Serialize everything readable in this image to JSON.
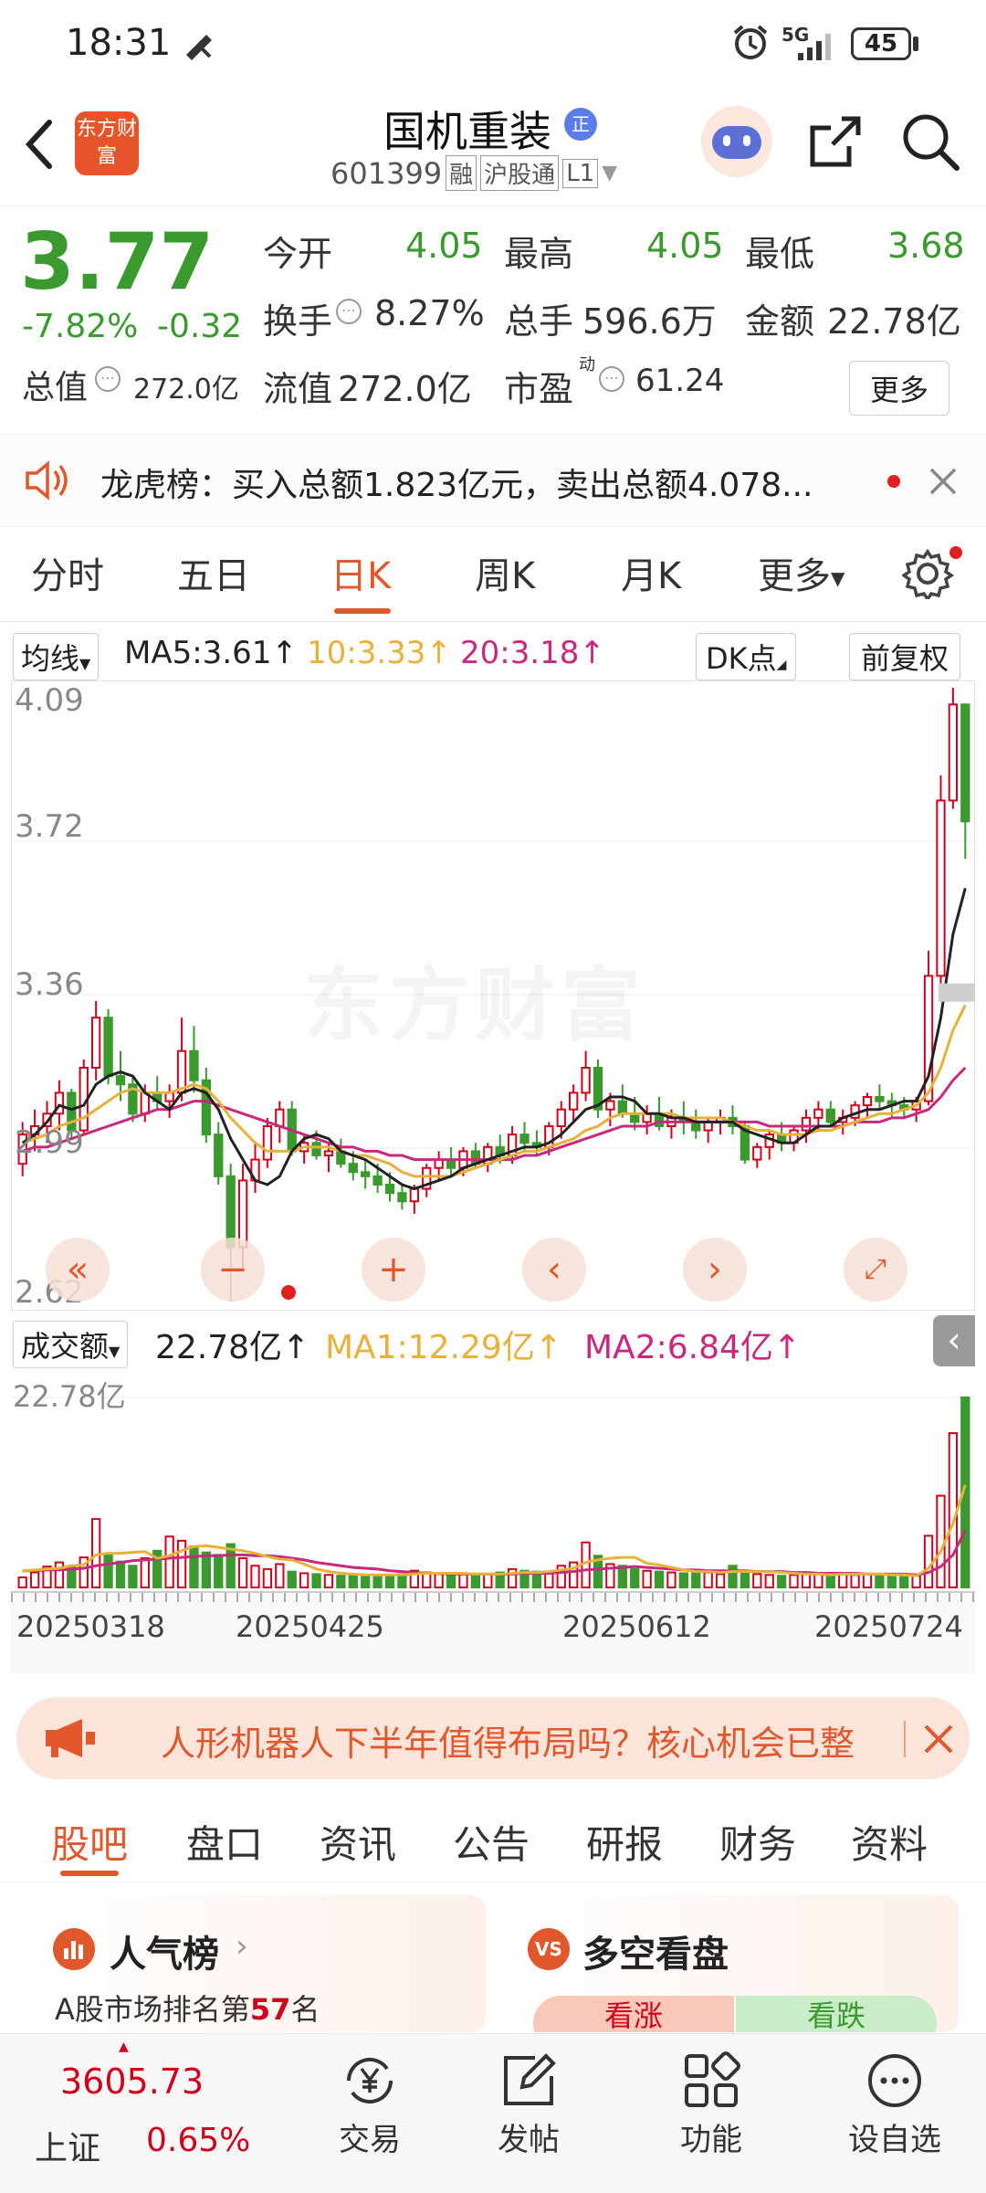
{
  "status": {
    "time": "18:31",
    "battery": "45",
    "network": "5G"
  },
  "header": {
    "app_badge": "东方财富",
    "stock_name": "国机重装",
    "code": "601399",
    "tag_margin": "融",
    "tag_connect": "沪股通",
    "tag_level": "L1",
    "badge_official": "正"
  },
  "quote": {
    "price": "3.77",
    "change_pct": "-7.82%",
    "change": "-0.32",
    "open_label": "今开",
    "open": "4.05",
    "high_label": "最高",
    "high": "4.05",
    "low_label": "最低",
    "low": "3.68",
    "turnover_label": "换手",
    "turnover": "8.27%",
    "volume_label": "总手",
    "volume": "596.6万",
    "amount_label": "金额",
    "amount": "22.78亿",
    "mcap_label": "总值",
    "mcap": "272.0亿",
    "float_label": "流值",
    "float": "272.0亿",
    "pe_label": "市盈",
    "pe_sup": "动",
    "pe": "61.24",
    "more_label": "更多"
  },
  "lhb": {
    "text": "龙虎榜：买入总额1.823亿元，卖出总额4.078..."
  },
  "tabs": [
    "分时",
    "五日",
    "日K",
    "周K",
    "月K",
    "更多"
  ],
  "ma_bar": {
    "selector": "均线",
    "ma5": "MA5:3.61↑",
    "ma10": "10:3.33↑",
    "ma20": "20:3.18↑",
    "dk": "DK点",
    "adjust": "前复权"
  },
  "chart": {
    "price_labels": [
      "4.09",
      "3.72",
      "3.36",
      "2.99",
      "2.62"
    ],
    "watermark": "东方财富"
  },
  "vol_bar": {
    "selector": "成交额",
    "value": "22.78亿↑",
    "ma1": "MA1:12.29亿↑",
    "ma2": "MA2:6.84亿↑",
    "axis_label": "22.78亿",
    "dates": [
      "20250318",
      "20250425",
      "20250612",
      "20250724"
    ]
  },
  "banner": {
    "text": "人形机器人下半年值得布局吗？核心机会已整"
  },
  "subtabs": [
    "股吧",
    "盘口",
    "资讯",
    "公告",
    "研报",
    "财务",
    "资料"
  ],
  "cards": {
    "left_title": "人气榜",
    "left_text_prefix": "A股市场排名第",
    "left_rank": "57",
    "left_text_suffix": "名",
    "right_title": "多空看盘",
    "right_up": "看涨",
    "right_down": "看跌"
  },
  "bottom": {
    "index_value": "3605.73",
    "index_name": "上证",
    "index_change": "0.65%",
    "nav": [
      "交易",
      "发帖",
      "功能",
      "设自选"
    ]
  },
  "colors": {
    "accent": "#e0582b",
    "up": "#d0021b",
    "down": "#3a9a2e",
    "ma5": "#222222",
    "ma10": "#e8b13a",
    "ma20": "#c8287e"
  },
  "chart_data": {
    "type": "candlestick",
    "ylim": [
      2.62,
      4.09
    ],
    "candles": [
      [
        2.95,
        3.05,
        2.92,
        3.02
      ],
      [
        3.02,
        3.08,
        2.98,
        3.04
      ],
      [
        3.04,
        3.1,
        3.0,
        3.07
      ],
      [
        3.07,
        3.15,
        3.03,
        3.12
      ],
      [
        3.12,
        3.13,
        3.01,
        3.03
      ],
      [
        3.03,
        3.2,
        3.02,
        3.18
      ],
      [
        3.18,
        3.34,
        3.15,
        3.3
      ],
      [
        3.3,
        3.32,
        3.14,
        3.16
      ],
      [
        3.16,
        3.22,
        3.1,
        3.14
      ],
      [
        3.14,
        3.16,
        3.05,
        3.07
      ],
      [
        3.07,
        3.14,
        3.05,
        3.12
      ],
      [
        3.12,
        3.16,
        3.08,
        3.1
      ],
      [
        3.1,
        3.14,
        3.06,
        3.12
      ],
      [
        3.12,
        3.3,
        3.1,
        3.22
      ],
      [
        3.22,
        3.28,
        3.12,
        3.15
      ],
      [
        3.15,
        3.18,
        3.0,
        3.02
      ],
      [
        3.02,
        3.05,
        2.9,
        2.92
      ],
      [
        2.92,
        2.95,
        2.62,
        2.75
      ],
      [
        2.75,
        2.95,
        2.7,
        2.91
      ],
      [
        2.91,
        3.0,
        2.88,
        2.96
      ],
      [
        2.96,
        3.06,
        2.94,
        3.04
      ],
      [
        3.04,
        3.1,
        3.0,
        3.08
      ],
      [
        3.08,
        3.1,
        2.97,
        2.98
      ],
      [
        2.98,
        3.02,
        2.95,
        3.0
      ],
      [
        3.0,
        3.03,
        2.96,
        2.97
      ],
      [
        2.97,
        3.0,
        2.93,
        2.98
      ],
      [
        2.98,
        3.01,
        2.94,
        2.95
      ],
      [
        2.95,
        2.98,
        2.91,
        2.93
      ],
      [
        2.93,
        2.96,
        2.89,
        2.92
      ],
      [
        2.92,
        2.95,
        2.88,
        2.9
      ],
      [
        2.9,
        2.93,
        2.86,
        2.88
      ],
      [
        2.88,
        2.9,
        2.84,
        2.86
      ],
      [
        2.86,
        2.9,
        2.83,
        2.89
      ],
      [
        2.89,
        2.95,
        2.87,
        2.94
      ],
      [
        2.94,
        2.98,
        2.91,
        2.96
      ],
      [
        2.96,
        2.99,
        2.92,
        2.94
      ],
      [
        2.94,
        2.99,
        2.92,
        2.98
      ],
      [
        2.98,
        3.0,
        2.94,
        2.95
      ],
      [
        2.95,
        3.0,
        2.93,
        2.99
      ],
      [
        2.99,
        3.02,
        2.95,
        2.97
      ],
      [
        2.97,
        3.04,
        2.95,
        3.02
      ],
      [
        3.02,
        3.05,
        2.98,
        3.0
      ],
      [
        3.0,
        3.03,
        2.97,
        2.99
      ],
      [
        2.99,
        3.05,
        2.97,
        3.04
      ],
      [
        3.04,
        3.1,
        3.01,
        3.08
      ],
      [
        3.08,
        3.14,
        3.05,
        3.12
      ],
      [
        3.12,
        3.22,
        3.1,
        3.18
      ],
      [
        3.18,
        3.2,
        3.06,
        3.08
      ],
      [
        3.08,
        3.12,
        3.04,
        3.1
      ],
      [
        3.1,
        3.14,
        3.06,
        3.07
      ],
      [
        3.07,
        3.11,
        3.03,
        3.05
      ],
      [
        3.05,
        3.09,
        3.02,
        3.07
      ],
      [
        3.07,
        3.11,
        3.03,
        3.04
      ],
      [
        3.04,
        3.08,
        3.01,
        3.06
      ],
      [
        3.06,
        3.1,
        3.02,
        3.05
      ],
      [
        3.05,
        3.08,
        3.01,
        3.03
      ],
      [
        3.03,
        3.06,
        3.0,
        3.05
      ],
      [
        3.05,
        3.08,
        3.02,
        3.06
      ],
      [
        3.06,
        3.09,
        3.02,
        3.04
      ],
      [
        3.04,
        3.05,
        2.95,
        2.96
      ],
      [
        2.96,
        3.0,
        2.94,
        2.99
      ],
      [
        2.99,
        3.03,
        2.96,
        3.02
      ],
      [
        3.02,
        3.05,
        2.98,
        3.0
      ],
      [
        3.0,
        3.04,
        2.98,
        3.03
      ],
      [
        3.03,
        3.08,
        3.0,
        3.06
      ],
      [
        3.06,
        3.1,
        3.03,
        3.08
      ],
      [
        3.08,
        3.1,
        3.04,
        3.05
      ],
      [
        3.05,
        3.08,
        3.02,
        3.06
      ],
      [
        3.06,
        3.1,
        3.04,
        3.09
      ],
      [
        3.09,
        3.12,
        3.06,
        3.11
      ],
      [
        3.11,
        3.14,
        3.08,
        3.1
      ],
      [
        3.1,
        3.12,
        3.06,
        3.09
      ],
      [
        3.09,
        3.11,
        3.06,
        3.08
      ],
      [
        3.08,
        3.11,
        3.05,
        3.1
      ],
      [
        3.1,
        3.46,
        3.09,
        3.4
      ],
      [
        3.4,
        3.88,
        3.38,
        3.82
      ],
      [
        3.82,
        4.09,
        3.8,
        4.05
      ],
      [
        4.05,
        4.05,
        3.68,
        3.77
      ]
    ],
    "ma5": [
      3.0,
      3.02,
      3.05,
      3.09,
      3.08,
      3.09,
      3.14,
      3.16,
      3.17,
      3.16,
      3.12,
      3.1,
      3.08,
      3.12,
      3.13,
      3.12,
      3.08,
      3.01,
      2.96,
      2.91,
      2.9,
      2.92,
      2.98,
      3.01,
      3.02,
      3.01,
      2.98,
      2.97,
      2.96,
      2.94,
      2.92,
      2.9,
      2.89,
      2.9,
      2.91,
      2.92,
      2.94,
      2.95,
      2.96,
      2.97,
      2.98,
      2.99,
      2.99,
      3.0,
      3.02,
      3.05,
      3.08,
      3.09,
      3.11,
      3.11,
      3.1,
      3.07,
      3.07,
      3.06,
      3.06,
      3.05,
      3.05,
      3.05,
      3.05,
      3.03,
      3.02,
      3.01,
      3.0,
      3.0,
      3.02,
      3.04,
      3.04,
      3.06,
      3.07,
      3.08,
      3.08,
      3.09,
      3.1,
      3.1,
      3.16,
      3.3,
      3.5,
      3.61
    ],
    "ma10": [
      3.0,
      3.01,
      3.02,
      3.04,
      3.05,
      3.06,
      3.08,
      3.1,
      3.12,
      3.13,
      3.12,
      3.12,
      3.12,
      3.13,
      3.14,
      3.13,
      3.1,
      3.06,
      3.03,
      3.0,
      2.98,
      2.98,
      2.98,
      2.99,
      2.99,
      2.99,
      2.98,
      2.97,
      2.97,
      2.96,
      2.95,
      2.93,
      2.92,
      2.92,
      2.92,
      2.92,
      2.93,
      2.94,
      2.95,
      2.96,
      2.97,
      2.98,
      2.98,
      2.99,
      3.0,
      3.01,
      3.03,
      3.04,
      3.06,
      3.07,
      3.07,
      3.07,
      3.07,
      3.07,
      3.06,
      3.06,
      3.06,
      3.06,
      3.05,
      3.04,
      3.03,
      3.03,
      3.02,
      3.02,
      3.02,
      3.03,
      3.03,
      3.04,
      3.05,
      3.06,
      3.07,
      3.07,
      3.08,
      3.09,
      3.12,
      3.18,
      3.27,
      3.33
    ],
    "ma20": [
      2.98,
      2.99,
      2.99,
      3.0,
      3.01,
      3.02,
      3.03,
      3.04,
      3.05,
      3.06,
      3.07,
      3.08,
      3.08,
      3.09,
      3.1,
      3.1,
      3.09,
      3.08,
      3.07,
      3.06,
      3.05,
      3.04,
      3.03,
      3.02,
      3.01,
      3.0,
      2.99,
      2.99,
      2.98,
      2.98,
      2.97,
      2.97,
      2.96,
      2.96,
      2.96,
      2.96,
      2.96,
      2.96,
      2.96,
      2.96,
      2.96,
      2.97,
      2.97,
      2.98,
      2.99,
      3.0,
      3.01,
      3.02,
      3.03,
      3.04,
      3.04,
      3.04,
      3.05,
      3.05,
      3.05,
      3.05,
      3.05,
      3.05,
      3.05,
      3.05,
      3.05,
      3.04,
      3.04,
      3.04,
      3.04,
      3.04,
      3.04,
      3.04,
      3.05,
      3.05,
      3.05,
      3.06,
      3.06,
      3.07,
      3.08,
      3.11,
      3.15,
      3.18
    ],
    "volume": [
      1.2,
      1.8,
      2.5,
      3.0,
      2.4,
      3.6,
      8.2,
      4.0,
      3.1,
      2.6,
      3.5,
      4.4,
      6.1,
      5.6,
      4.9,
      4.2,
      3.9,
      5.2,
      3.5,
      2.6,
      2.2,
      2.8,
      1.9,
      1.7,
      1.6,
      1.5,
      1.4,
      1.6,
      1.4,
      1.3,
      1.5,
      1.6,
      2.0,
      1.8,
      1.6,
      1.5,
      1.7,
      1.6,
      1.6,
      1.8,
      2.2,
      2.0,
      1.9,
      1.8,
      2.6,
      3.0,
      5.4,
      3.8,
      2.8,
      2.6,
      2.2,
      2.0,
      1.9,
      1.8,
      1.7,
      2.0,
      1.8,
      1.6,
      2.6,
      2.0,
      1.6,
      1.5,
      1.4,
      1.5,
      1.6,
      1.7,
      1.5,
      1.6,
      1.5,
      1.6,
      1.5,
      1.4,
      1.3,
      1.4,
      6.2,
      11.0,
      18.5,
      22.78
    ],
    "vol_ma1": [
      2.0,
      2.1,
      2.2,
      2.3,
      2.6,
      2.7,
      3.9,
      4.1,
      4.1,
      4.2,
      4.3,
      3.5,
      3.8,
      4.4,
      4.9,
      5.0,
      4.8,
      4.6,
      4.4,
      4.1,
      3.7,
      3.4,
      3.3,
      2.8,
      2.2,
      1.9,
      1.7,
      1.6,
      1.5,
      1.5,
      1.5,
      1.5,
      1.6,
      1.7,
      1.7,
      1.7,
      1.7,
      1.6,
      1.6,
      1.6,
      1.7,
      1.8,
      1.8,
      1.9,
      2.1,
      2.3,
      3.0,
      3.3,
      3.5,
      3.6,
      3.6,
      2.9,
      2.7,
      2.4,
      2.1,
      1.9,
      1.9,
      1.8,
      1.9,
      1.9,
      1.9,
      1.9,
      1.8,
      1.7,
      1.6,
      1.6,
      1.5,
      1.6,
      1.6,
      1.6,
      1.6,
      1.5,
      1.5,
      1.4,
      2.3,
      4.3,
      7.7,
      12.29
    ],
    "vol_ma2": [
      2.0,
      2.0,
      2.1,
      2.1,
      2.2,
      2.3,
      2.6,
      2.8,
      3.0,
      3.2,
      3.3,
      3.4,
      3.5,
      3.6,
      3.7,
      3.8,
      3.8,
      3.9,
      3.9,
      3.8,
      3.8,
      3.7,
      3.5,
      3.3,
      3.0,
      2.8,
      2.6,
      2.4,
      2.3,
      2.2,
      2.0,
      1.9,
      1.8,
      1.7,
      1.7,
      1.6,
      1.6,
      1.6,
      1.6,
      1.6,
      1.6,
      1.7,
      1.7,
      1.7,
      1.8,
      1.9,
      2.1,
      2.2,
      2.3,
      2.4,
      2.5,
      2.4,
      2.3,
      2.2,
      2.1,
      2.1,
      2.0,
      2.0,
      2.0,
      2.0,
      1.9,
      1.9,
      1.9,
      1.8,
      1.8,
      1.7,
      1.7,
      1.7,
      1.7,
      1.6,
      1.6,
      1.6,
      1.6,
      1.5,
      1.8,
      2.5,
      3.9,
      6.84
    ]
  }
}
